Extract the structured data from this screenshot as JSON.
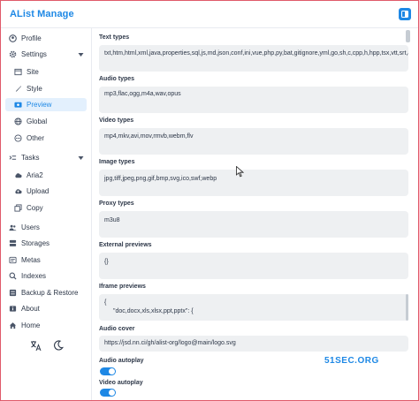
{
  "app": {
    "title": "AList Manage",
    "accent": "#1e88e5",
    "border": "#e05a6a"
  },
  "sidebar": {
    "items": [
      {
        "label": "Profile",
        "icon": "user-icon"
      },
      {
        "label": "Settings",
        "icon": "gear-icon"
      },
      {
        "label": "Site",
        "icon": "window-icon"
      },
      {
        "label": "Style",
        "icon": "brush-icon"
      },
      {
        "label": "Preview",
        "icon": "eye-icon"
      },
      {
        "label": "Global",
        "icon": "globe-icon"
      },
      {
        "label": "Other",
        "icon": "dots-icon"
      },
      {
        "label": "Tasks",
        "icon": "tasks-icon"
      },
      {
        "label": "Aria2",
        "icon": "cloud-icon"
      },
      {
        "label": "Upload",
        "icon": "upload-icon"
      },
      {
        "label": "Copy",
        "icon": "copy-icon"
      },
      {
        "label": "Users",
        "icon": "users-icon"
      },
      {
        "label": "Storages",
        "icon": "database-icon"
      },
      {
        "label": "Metas",
        "icon": "meta-icon"
      },
      {
        "label": "Indexes",
        "icon": "search-icon"
      },
      {
        "label": "Backup & Restore",
        "icon": "backup-icon"
      },
      {
        "label": "About",
        "icon": "info-icon"
      },
      {
        "label": "Home",
        "icon": "home-icon"
      }
    ]
  },
  "fields": {
    "text_types": {
      "label": "Text types",
      "value": "txt,htm,html,xml,java,properties,sql,js,md,json,conf,ini,vue,php,py,bat,gitignore,yml,go,sh,c,cpp,h,hpp,tsx,vtt,srt,ass,rs,lrc"
    },
    "audio_types": {
      "label": "Audio types",
      "value": "mp3,flac,ogg,m4a,wav,opus"
    },
    "video_types": {
      "label": "Video types",
      "value": "mp4,mkv,avi,mov,rmvb,webm,flv"
    },
    "image_types": {
      "label": "Image types",
      "value": "jpg,tiff,jpeg,png,gif,bmp,svg,ico,swf,webp"
    },
    "proxy_types": {
      "label": "Proxy types",
      "value": "m3u8"
    },
    "external_previews": {
      "label": "External previews",
      "value": "{}"
    },
    "iframe_previews": {
      "label": "Iframe previews",
      "line1": "{",
      "line2": "\"doc,docx,xls,xlsx,ppt,pptx\": {"
    },
    "audio_cover": {
      "label": "Audio cover",
      "value": "https://jsd.nn.ci/gh/alist-org/logo@main/logo.svg"
    },
    "audio_autoplay": {
      "label": "Audio autoplay",
      "on": true
    },
    "video_autoplay": {
      "label": "Video autoplay",
      "on": true
    }
  },
  "watermark": "51SEC.ORG"
}
